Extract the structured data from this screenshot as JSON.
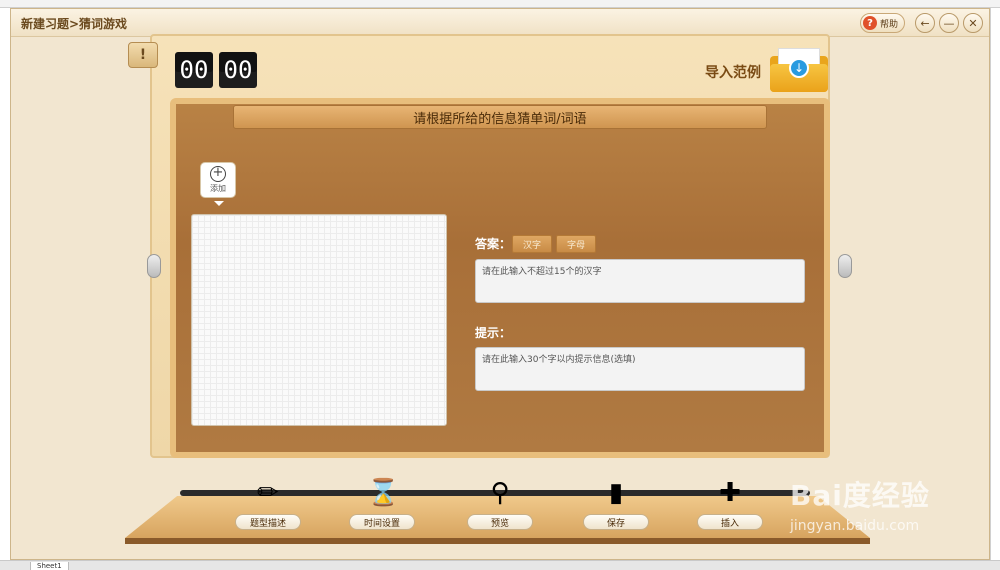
{
  "window": {
    "title": "新建习题>猜词游戏",
    "help_label": "帮助",
    "back_symbol": "←",
    "minimize_symbol": "—",
    "close_symbol": "✕"
  },
  "timer": {
    "minutes": "00",
    "seconds": "00"
  },
  "import": {
    "label": "导入范例"
  },
  "banner": {
    "text": "请根据所给的信息猜单词/词语"
  },
  "add_button": {
    "label": "添加"
  },
  "answer": {
    "label": "答案：",
    "option_hanzi": "汉字",
    "option_letters": "字母",
    "placeholder": "请在此输入不超过15个的汉字"
  },
  "hint": {
    "label": "提示：",
    "placeholder": "请在此输入30个字以内提示信息(选填)"
  },
  "toolbar": [
    {
      "label": "题型描述",
      "icon": "pencil-icon"
    },
    {
      "label": "时间设置",
      "icon": "hourglass-icon"
    },
    {
      "label": "预览",
      "icon": "magnifier-icon"
    },
    {
      "label": "保存",
      "icon": "usb-drive-icon"
    },
    {
      "label": "插入",
      "icon": "insert-icon"
    }
  ],
  "background": {
    "sheet_tab": "Sheet1"
  },
  "watermark": {
    "brand": "Bai度经验",
    "site": "jingyan.baidu.com"
  },
  "colors": {
    "accent": "#e9a51c",
    "wood": "#b07a42",
    "title_text": "#6b4a1f"
  }
}
